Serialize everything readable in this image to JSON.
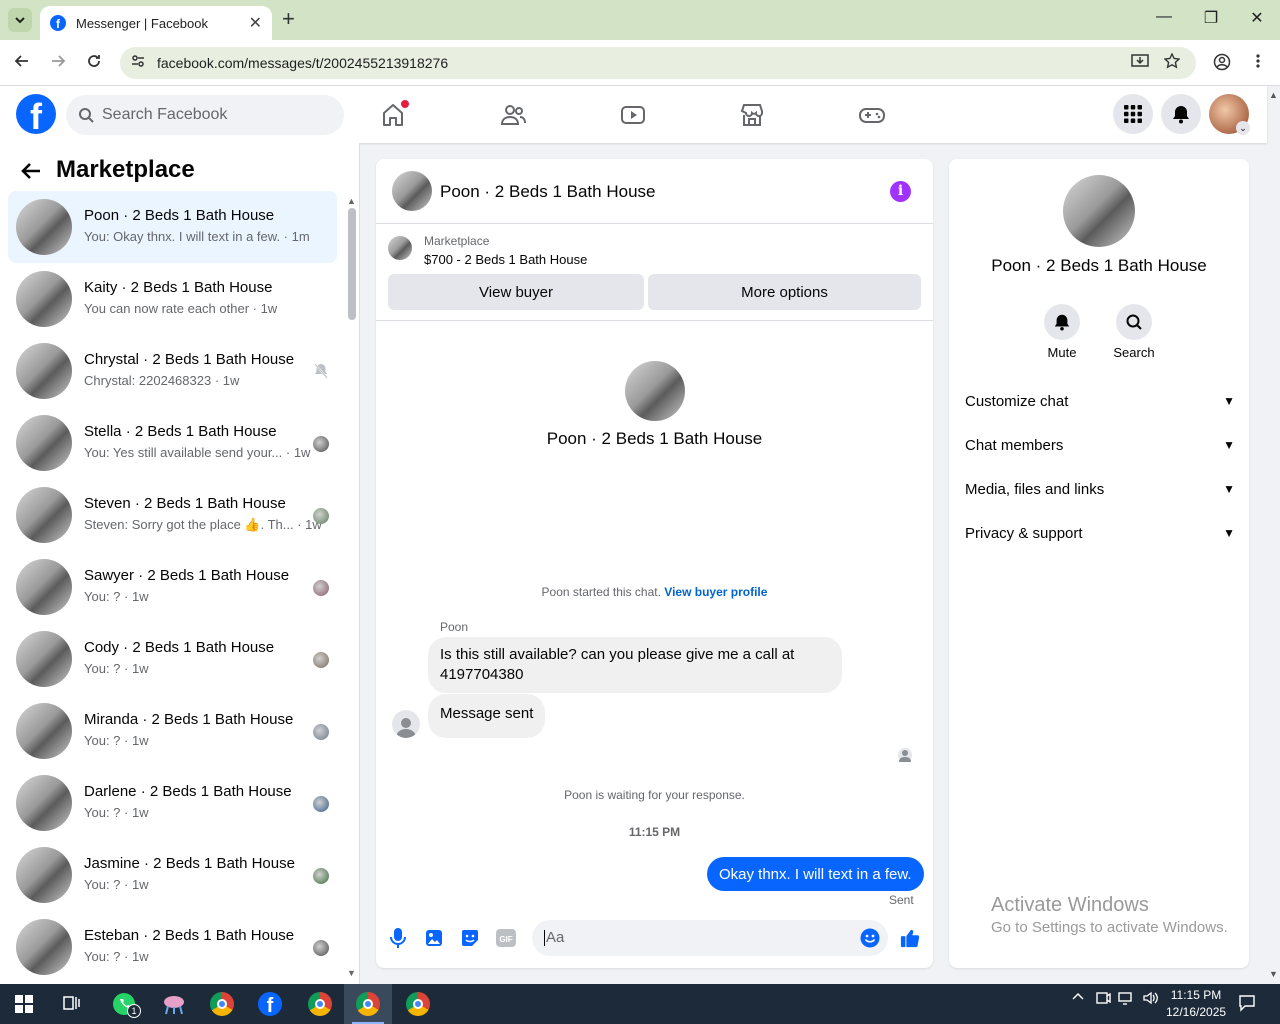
{
  "browser": {
    "tab_title": "Messenger | Facebook",
    "tab_close": "✕",
    "new_tab": "+",
    "url": "facebook.com/messages/t/2002455213918276",
    "minimize": "—",
    "maximize": "❐",
    "close": "✕"
  },
  "fb": {
    "logo": "f",
    "search_placeholder": "Search Facebook"
  },
  "left": {
    "title": "Marketplace",
    "conversations": [
      {
        "name": "Poon · 2 Beds 1 Bath House",
        "preview": "You: Okay thnx. I will text in a few. · 1m",
        "active": true
      },
      {
        "name": "Kaity · 2 Beds 1 Bath House",
        "preview": "You can now rate each other · 1w"
      },
      {
        "name": "Chrystal · 2 Beds 1 Bath House",
        "preview": "Chrystal: 2202468323 · 1w",
        "muted": true
      },
      {
        "name": "Stella · 2 Beds 1 Bath House",
        "preview": "You: Yes still available send your... · 1w"
      },
      {
        "name": "Steven · 2 Beds 1 Bath House",
        "preview": "Steven: Sorry got the place 👍. Th... · 1w"
      },
      {
        "name": "Sawyer · 2 Beds 1 Bath House",
        "preview": "You: ? · 1w"
      },
      {
        "name": "Cody · 2 Beds 1 Bath House",
        "preview": "You: ? · 1w"
      },
      {
        "name": "Miranda · 2 Beds 1 Bath House",
        "preview": "You: ? · 1w"
      },
      {
        "name": "Darlene · 2 Beds 1 Bath House",
        "preview": "You: ? · 1w"
      },
      {
        "name": "Jasmine · 2 Beds 1 Bath House",
        "preview": "You: ? · 1w"
      },
      {
        "name": "Esteban · 2 Beds 1 Bath House",
        "preview": "You: ? · 1w"
      }
    ]
  },
  "chat": {
    "title": "Poon · 2 Beds 1 Bath House",
    "marketplace_label": "Marketplace",
    "listing": "$700 - 2 Beds 1 Bath House",
    "view_buyer": "View buyer",
    "more_options": "More options",
    "hero_name": "Poon · 2 Beds 1 Bath House",
    "started_text": "Poon started this chat.",
    "view_buyer_profile": "View buyer profile",
    "sender": "Poon",
    "msg1": "Is this still available? can you please give me a call at 4197704380",
    "msg2": "Message sent",
    "waiting": "Poon is waiting for your response.",
    "time": "11:15 PM",
    "msg_out": "Okay thnx. I will text in a few.",
    "sent": "Sent",
    "composer_placeholder": "Aa"
  },
  "right": {
    "name": "Poon · 2 Beds 1 Bath House",
    "mute": "Mute",
    "search": "Search",
    "sections": [
      "Customize chat",
      "Chat members",
      "Media, files and links",
      "Privacy & support"
    ],
    "watermark_title": "Activate Windows",
    "watermark_sub": "Go to Settings to activate Windows."
  },
  "taskbar": {
    "clock_time": "11:15 PM",
    "clock_date": "12/16/2025",
    "whatsapp_badge": "1"
  },
  "colors": {
    "accent": "#0866ff",
    "info": "#a033ff"
  }
}
